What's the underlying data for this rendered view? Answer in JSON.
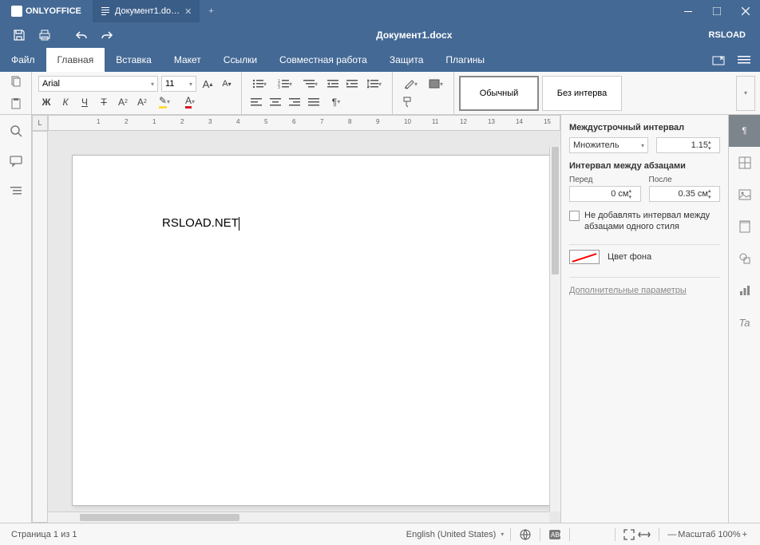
{
  "app": {
    "name": "ONLYOFFICE"
  },
  "tab": {
    "title": "Документ1.do…"
  },
  "doc_title": "Документ1.docx",
  "user": "RSLOAD",
  "menu": [
    "Файл",
    "Главная",
    "Вставка",
    "Макет",
    "Ссылки",
    "Совместная работа",
    "Защита",
    "Плагины"
  ],
  "active_menu": 1,
  "font": {
    "name": "Arial",
    "size": "11"
  },
  "styles": {
    "normal": "Обычный",
    "no_spacing": "Без интерва"
  },
  "right_panel": {
    "line_spacing_label": "Междустрочный интервал",
    "line_spacing_mode": "Множитель",
    "line_spacing_value": "1.15",
    "para_spacing_label": "Интервал между абзацами",
    "before_label": "Перед",
    "before_value": "0 см",
    "after_label": "После",
    "after_value": "0.35 см",
    "no_spacing_same_style": "Не добавлять интервал между абзацами одного стиля",
    "bg_color_label": "Цвет фона",
    "advanced_link": "Дополнительные параметры"
  },
  "document_text": "RSLOAD.NET",
  "status": {
    "page_info": "Страница 1 из 1",
    "language": "English (United States)",
    "zoom_label": "Масштаб 100%"
  },
  "ruler_corner": "L"
}
